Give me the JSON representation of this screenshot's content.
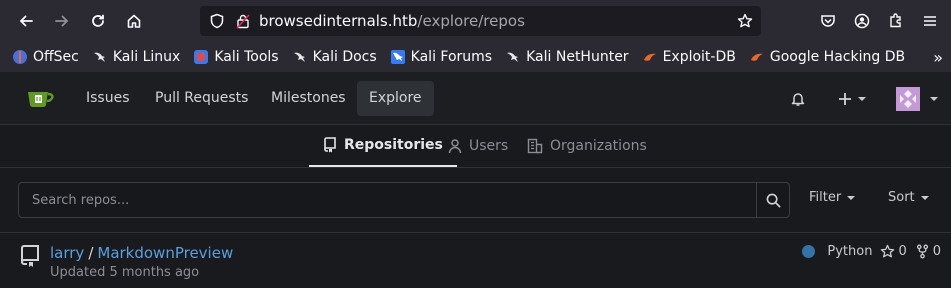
{
  "browser": {
    "url_host": "browsedinternals.htb",
    "url_path": "/explore/repos",
    "bookmarks": [
      {
        "label": "OffSec",
        "icon": "offsec-icon"
      },
      {
        "label": "Kali Linux",
        "icon": "kali-dragon-icon"
      },
      {
        "label": "Kali Tools",
        "icon": "kali-tools-icon"
      },
      {
        "label": "Kali Docs",
        "icon": "kali-dragon-icon"
      },
      {
        "label": "Kali Forums",
        "icon": "kali-forums-icon"
      },
      {
        "label": "Kali NetHunter",
        "icon": "kali-dragon-icon"
      },
      {
        "label": "Exploit-DB",
        "icon": "exploitdb-icon"
      },
      {
        "label": "Google Hacking DB",
        "icon": "exploitdb-icon"
      }
    ]
  },
  "nav": {
    "items": [
      "Issues",
      "Pull Requests",
      "Milestones",
      "Explore"
    ],
    "active": "Explore"
  },
  "tabs": {
    "repositories": "Repositories",
    "users": "Users",
    "organizations": "Organizations"
  },
  "search": {
    "placeholder": "Search repos...",
    "filter_label": "Filter",
    "sort_label": "Sort"
  },
  "repos": [
    {
      "owner": "larry",
      "name": "MarkdownPreview",
      "updated": "Updated 5 months ago",
      "language": "Python",
      "language_color": "#3572a5",
      "stars": "0",
      "forks": "0"
    }
  ],
  "colors": {
    "link": "#5b9fe0",
    "background": "#181a1d",
    "header": "#1c1e21"
  }
}
